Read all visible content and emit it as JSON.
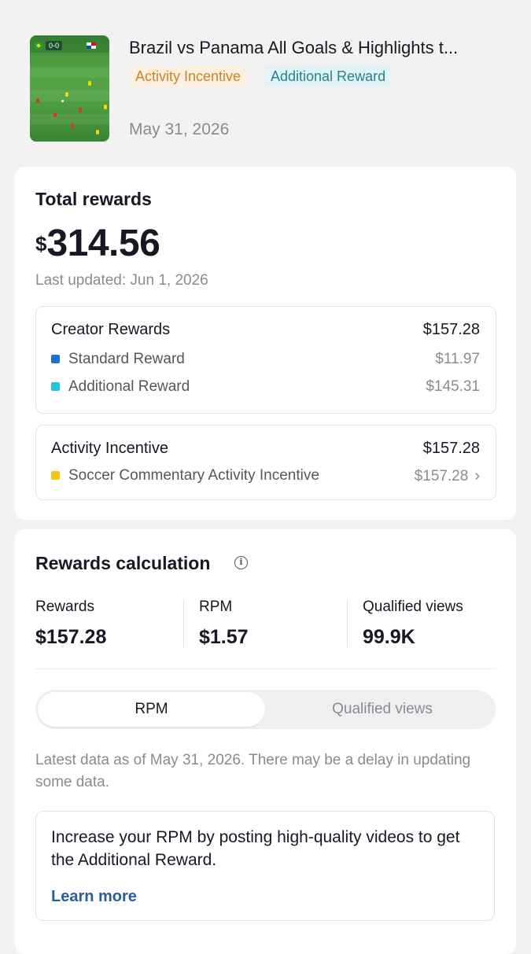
{
  "video": {
    "title": "Brazil vs Panama All Goals & Highlights t...",
    "thumbnail_score": "0-0",
    "tags": [
      "Activity Incentive",
      "Additional Reward"
    ],
    "date": "May 31, 2026"
  },
  "total": {
    "title": "Total rewards",
    "currency": "$",
    "amount": "314.56",
    "last_updated": "Last updated: Jun 1, 2026"
  },
  "creator_rewards": {
    "label": "Creator Rewards",
    "value": "$157.28",
    "items": [
      {
        "label": "Standard Reward",
        "value": "$11.97",
        "color": "#1d6fd1"
      },
      {
        "label": "Additional Reward",
        "value": "$145.31",
        "color": "#25c4d8"
      }
    ]
  },
  "activity_incentive": {
    "label": "Activity Incentive",
    "value": "$157.28",
    "items": [
      {
        "label": "Soccer Commentary Activity Incentive",
        "value": "$157.28",
        "color": "#f5c518",
        "chevron": "›"
      }
    ]
  },
  "calc": {
    "title": "Rewards calculation",
    "info_icon": "i",
    "metrics": [
      {
        "label": "Rewards",
        "value": "$157.28"
      },
      {
        "label": "RPM",
        "value": "$1.57"
      },
      {
        "label": "Qualified views",
        "value": "99.9K"
      }
    ],
    "tabs": [
      "RPM",
      "Qualified views"
    ],
    "selected_tab": "RPM",
    "note": "Latest data as of May 31, 2026. There may be a delay in updating some data.",
    "tip": "Increase your RPM by posting high-quality videos to get the Additional Reward.",
    "learn_more": "Learn more"
  },
  "colors": {
    "tag_activity_bg": "#fdf0de",
    "tag_activity_fg": "#c9832b",
    "tag_additional_bg": "#e2f3f6",
    "tag_additional_fg": "#26808f",
    "link": "#2b5d9b"
  }
}
